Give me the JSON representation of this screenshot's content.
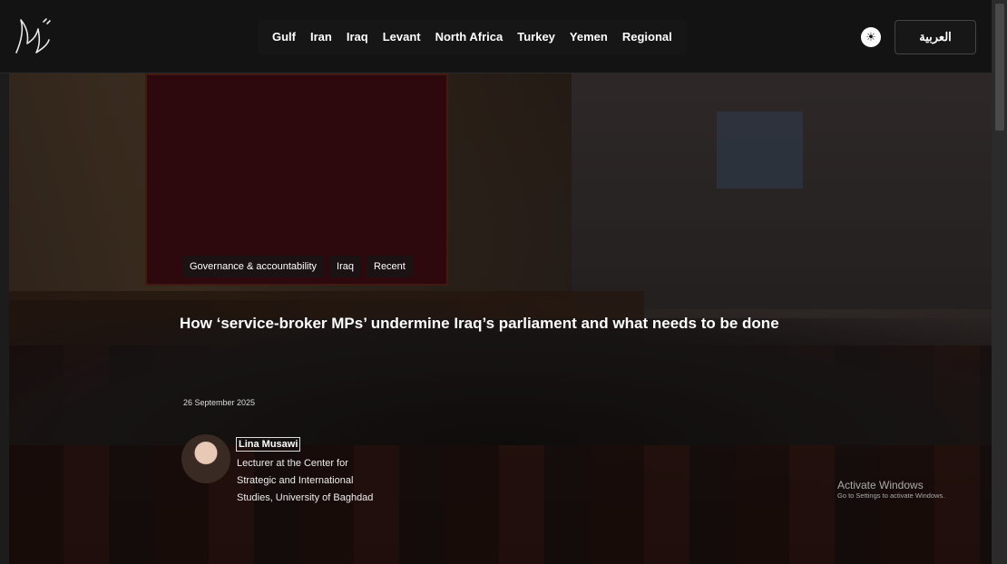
{
  "header": {
    "logo_icon": "calligraphy-logo",
    "nav": [
      "Gulf",
      "Iran",
      "Iraq",
      "Levant",
      "North Africa",
      "Turkey",
      "Yemen",
      "Regional"
    ],
    "theme_icon": "sun-icon",
    "theme_glyph": "☀",
    "language_label": "العربية"
  },
  "hero": {
    "tags": [
      "Governance & accountability",
      "Iraq",
      "Recent"
    ],
    "title": "How ‘service-broker MPs’ undermine Iraq’s parliament and what needs to be done",
    "date": "26 September 2025",
    "author": {
      "name": "Lina Musawi",
      "bio": "Lecturer at the Center for Strategic and International Studies, University of Baghdad"
    }
  },
  "watermark": {
    "line1": "Activate Windows",
    "line2": "Go to Settings to activate Windows."
  }
}
